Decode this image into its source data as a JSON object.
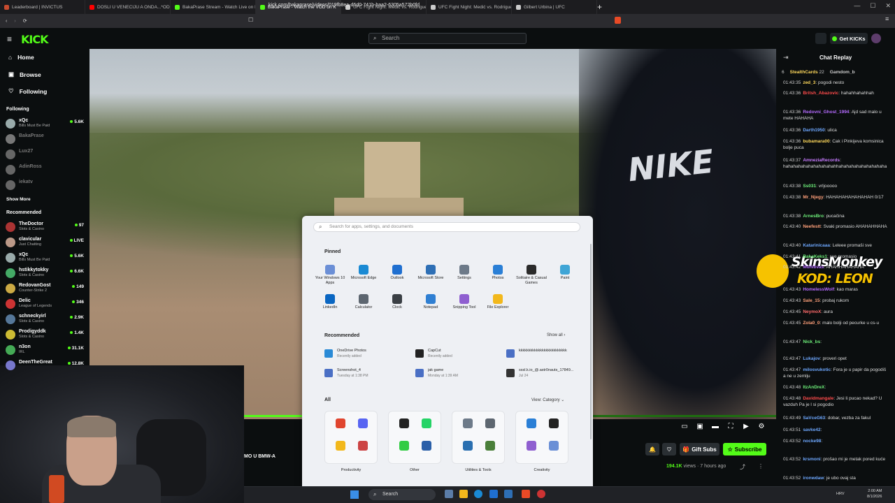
{
  "browser": {
    "tabs": [
      {
        "title": "Leaderboard | INVICTUS",
        "color": "#c84b2f"
      },
      {
        "title": "DOSLI U VENECIJU A ONDA...*ODLE",
        "color": "#ff0000"
      },
      {
        "title": "BakaPrase Stream - Watch Live on K",
        "color": "#53fc18"
      },
      {
        "title": "BakaPrase - Watch the VOD on K",
        "color": "#53fc18"
      },
      {
        "title": "UFC Fight Night: Medić vs. Rodrigue",
        "color": "#cccccc"
      },
      {
        "title": "UFC Fight Night: Medić vs. Rodrigue",
        "color": "#cccccc"
      },
      {
        "title": "Gilbert Urbina | UFC",
        "color": "#cccccc"
      }
    ],
    "url": "kick.com/bakaprase/videos/019fb8ea-d6d0-741b-baa2-6305a572b0fd"
  },
  "header": {
    "logo": "KICK",
    "search_placeholder": "Search",
    "get_kicks": "Get KICKs"
  },
  "sidebar": {
    "nav": [
      "Home",
      "Browse",
      "Following"
    ],
    "following_title": "Following",
    "following": [
      {
        "name": "xQc",
        "sub": "Bills Must Be Paid",
        "count": "5.6K",
        "live": true,
        "color": "#9aa"
      },
      {
        "name": "BakaPrase",
        "sub": "",
        "count": "",
        "live": false,
        "color": "#777"
      },
      {
        "name": "Lux27",
        "sub": "",
        "count": "",
        "live": false,
        "color": "#666"
      },
      {
        "name": "AdinRoss",
        "sub": "",
        "count": "",
        "live": false,
        "color": "#666"
      },
      {
        "name": "iekatv",
        "sub": "",
        "count": "",
        "live": false,
        "color": "#666"
      }
    ],
    "show_more": "Show More",
    "recommended_title": "Recommended",
    "recommended": [
      {
        "name": "TheDoctor",
        "sub": "Slots & Casino",
        "count": "97",
        "color": "#a33"
      },
      {
        "name": "clavicular",
        "sub": "Just Chatting",
        "count": "LIVE",
        "color": "#b98"
      },
      {
        "name": "xQc",
        "sub": "Bills Must Be Paid",
        "count": "5.6K",
        "color": "#9aa"
      },
      {
        "name": "hstikkytokky",
        "sub": "Slots & Casino",
        "count": "6.6K",
        "color": "#4a6"
      },
      {
        "name": "RedovanGost",
        "sub": "Counter-Strike 2",
        "count": "149",
        "color": "#ca4"
      },
      {
        "name": "Delic",
        "sub": "League of Legends",
        "count": "346",
        "color": "#c33"
      },
      {
        "name": "schneckyirl",
        "sub": "Slots & Casino",
        "count": "2.9K",
        "color": "#579"
      },
      {
        "name": "Prodigyddk",
        "sub": "Slots & Casino",
        "count": "1.4K",
        "color": "#cb3"
      },
      {
        "name": "n3on",
        "sub": "IRL",
        "count": "31.1K",
        "color": "#4a5"
      },
      {
        "name": "DeenTheGreat",
        "sub": "",
        "count": "12.8K",
        "color": "#77c"
      }
    ]
  },
  "video": {
    "shirt_text": "NIKE",
    "stream_title": "MO U BMW-A",
    "views_num": "194.1K",
    "views_label": "views",
    "ago": "7 hours ago",
    "gift_subs": "Gift Subs",
    "subscribe": "Subscribe",
    "progress": 0.12
  },
  "start_menu": {
    "search_placeholder": "Search for apps, settings, and documents",
    "pinned_title": "Pinned",
    "pinned": [
      {
        "label": "Your Windows 10 Apps",
        "color": "#6b8fd6"
      },
      {
        "label": "Microsoft Edge",
        "color": "#1a8ad4"
      },
      {
        "label": "Outlook",
        "color": "#1f6fd0"
      },
      {
        "label": "Microsoft Store",
        "color": "#2e6fb5"
      },
      {
        "label": "Settings",
        "color": "#6d7a89"
      },
      {
        "label": "Photos",
        "color": "#2a7fd6"
      },
      {
        "label": "Solitaire & Casual Games",
        "color": "#2b2b2b"
      },
      {
        "label": "Paint",
        "color": "#3fa5d6"
      },
      {
        "label": "LinkedIn",
        "color": "#0a66c2"
      },
      {
        "label": "Calculator",
        "color": "#5d6670"
      },
      {
        "label": "Clock",
        "color": "#3a3f44"
      },
      {
        "label": "Notepad",
        "color": "#2f7fd2"
      },
      {
        "label": "Snipping Tool",
        "color": "#8f5fd0"
      },
      {
        "label": "File Explorer",
        "color": "#f2b81c"
      }
    ],
    "recommended_title": "Recommended",
    "show_all": "Show all",
    "recommended": [
      {
        "title": "OneDrive Photos",
        "sub": "Recently added",
        "color": "#2a8ad6"
      },
      {
        "title": "CapCut",
        "sub": "Recently added",
        "color": "#222222"
      },
      {
        "title": "kkkkkkkkkkkkkkkkkkkkkkkkk",
        "sub": "",
        "color": "#4a6fc4"
      },
      {
        "title": "Screenshot_4",
        "sub": "Tuesday at 1:38 PM",
        "color": "#4a6fc4"
      },
      {
        "title": "jak game",
        "sub": "Monday at 1:39 AM",
        "color": "#4a6fc4"
      },
      {
        "title": "sssl.k.io_@.astr0nauts_17849...",
        "sub": "Jul 24",
        "color": "#333333"
      }
    ],
    "all_title": "All",
    "view_category": "View: Category",
    "categories": [
      {
        "label": "Productivity",
        "icons": [
          "#e0452f",
          "#5865f2",
          "#f2b81c",
          "#c44"
        ]
      },
      {
        "label": "Other",
        "icons": [
          "#222222",
          "#25d366",
          "#3c4",
          "#2a5fa8"
        ]
      },
      {
        "label": "Utilities & Tools",
        "icons": [
          "#6d7a89",
          "#5d6670",
          "#2a6fb0",
          "#4a7f3a"
        ]
      },
      {
        "label": "Creativity",
        "icons": [
          "#2a7fd6",
          "#222222",
          "#8f5fd0",
          "#6a8fd6"
        ]
      }
    ]
  },
  "taskbar": {
    "search": "Search",
    "time": "2:00 AM",
    "date": "8/1/2026",
    "lang": "HRV"
  },
  "chat": {
    "title": "Chat Replay",
    "top_bar": [
      {
        "n": "6"
      },
      {
        "name": "StealthCards",
        "n": "22"
      },
      {
        "name": "Gamdom_b"
      }
    ],
    "messages": [
      {
        "time": "01:43:35",
        "user": "zed_3",
        "color": "#ffd95c",
        "text": "pogodi nesto"
      },
      {
        "time": "01:43:36",
        "user": "Britsh_Abazovic",
        "color": "#ff4b4b",
        "text": "hahahhahahhah"
      },
      {
        "time": "01:43:36",
        "user": "Redovni_Ghost_1994",
        "color": "#b56bff",
        "text": "Ajd sad malo u mete HAHAHA"
      },
      {
        "time": "01:43:36",
        "user": "Darth1950",
        "color": "#6ea8ff",
        "text": "ulica"
      },
      {
        "time": "01:43:36",
        "user": "bubamara00",
        "color": "#ffd95c",
        "text": "Cak i Pinkijeva komsinica bolje puca"
      },
      {
        "time": "01:43:37",
        "user": "AmneziaRecords",
        "color": "#c77bff",
        "text": "hahahahahahahahahahahhahahahahahahahahaha"
      },
      {
        "time": "01:43:38",
        "user": "Ss031",
        "color": "#6ef07a",
        "text": "vrljooooo"
      },
      {
        "time": "01:43:38",
        "user": "Mr_Njegy",
        "color": "#ffa07a",
        "text": "HAHAHAHAHAHAHAH 0/17"
      },
      {
        "time": "01:43:38",
        "user": "ArnesBro",
        "color": "#6ef07a",
        "text": "pucačina"
      },
      {
        "time": "01:43:40",
        "user": "Neefestt",
        "color": "#ffa07a",
        "text": "Svaki promasio AHAHAHHAHA"
      },
      {
        "time": "01:43:40",
        "user": "Katarinicaaa",
        "color": "#6ea8ff",
        "text": "Leleee promaši sve"
      },
      {
        "time": "01:43:41",
        "user": "BakaKeks1",
        "color": "#6ef07a",
        "text": "sve promasio"
      },
      {
        "time": "01:43:42",
        "user": "Muhibvas",
        "color": "#b56bff",
        "text": "AHAHHAHAHAHA"
      },
      {
        "time": "01:43:43",
        "user": "HomelessWolf",
        "color": "#b56bff",
        "text": "kao maras"
      },
      {
        "time": "01:43:43",
        "user": "Sale_15",
        "color": "#ffa07a",
        "text": "probaj rukom"
      },
      {
        "time": "01:43:45",
        "user": "NeymoX",
        "color": "#ff6b6b",
        "text": "aura"
      },
      {
        "time": "01:43:45",
        "user": "Zola0_0",
        "color": "#ffa07a",
        "text": "malo bolji od pecurke u cs-u"
      },
      {
        "time": "01:43:47",
        "user": "Nick_bs",
        "color": "#6ef07a",
        "text": ""
      },
      {
        "time": "01:43:47",
        "user": "Lukajov",
        "color": "#6ea8ff",
        "text": "proveri opet"
      },
      {
        "time": "01:43:47",
        "user": "milosvukotic",
        "color": "#6ea8ff",
        "text": "Fora je u papir da pogodiš a ne u zemlju"
      },
      {
        "time": "01:43:48",
        "user": "ItzAnDreX",
        "color": "#6ef07a",
        "text": ""
      },
      {
        "time": "01:43:48",
        "user": "Davidmangale",
        "color": "#ff4b4b",
        "text": "Jesi li pucao nekad? U vazduh Pa je l si pogodio"
      },
      {
        "time": "01:43:49",
        "user": "SaVceG63",
        "color": "#6ea8ff",
        "text": "dobar, vezba za fakul"
      },
      {
        "time": "01:43:51",
        "user": "savke42",
        "color": "#6ea8ff",
        "text": ""
      },
      {
        "time": "01:43:52",
        "user": "nocke98",
        "color": "#6ea8ff",
        "text": ""
      },
      {
        "time": "01:43:52",
        "user": "krsmoni",
        "color": "#6ea8ff",
        "text": "prošao mi je metak pored kuće"
      },
      {
        "time": "01:43:52",
        "user": "ironwdaw",
        "color": "#6ea8ff",
        "text": "je ubo ovaj sta"
      }
    ],
    "sponsor": {
      "line1": "SkinsMonkey",
      "line2": "KOD: LEON"
    }
  }
}
